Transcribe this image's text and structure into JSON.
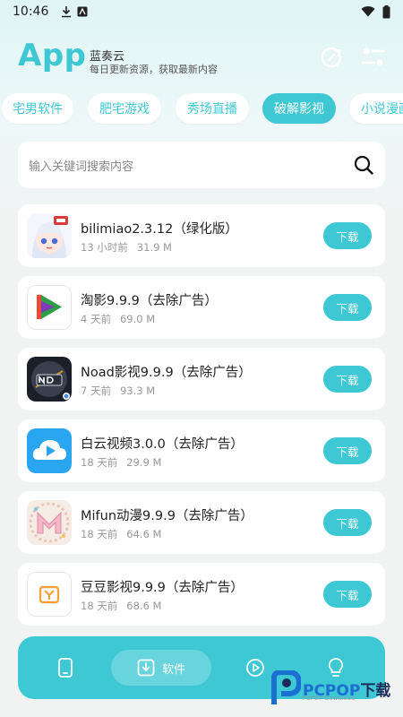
{
  "status_bar": {
    "time": "10:46"
  },
  "header": {
    "logo": "App",
    "name": "蓝奏云",
    "subtitle": "每日更新资源，获取最新内容"
  },
  "tabs": [
    {
      "label": "宅男软件",
      "active": false
    },
    {
      "label": "肥宅游戏",
      "active": false
    },
    {
      "label": "秀场直播",
      "active": false
    },
    {
      "label": "破解影视",
      "active": true
    },
    {
      "label": "小说漫画",
      "active": false
    }
  ],
  "search": {
    "placeholder": "输入关键词搜索内容"
  },
  "list": [
    {
      "title": "bilimiao2.3.12（绿化版）",
      "time": "13 小时前",
      "size": "31.9 M",
      "button": "下载",
      "icon": "bilimiao-icon"
    },
    {
      "title": "淘影9.9.9（去除广告）",
      "time": "4 天前",
      "size": "69.0 M",
      "button": "下载",
      "icon": "taoying-icon"
    },
    {
      "title": "Noad影视9.9.9（去除广告）",
      "time": "7 天前",
      "size": "93.3 M",
      "button": "下载",
      "icon": "noad-icon"
    },
    {
      "title": "白云视频3.0.0（去除广告）",
      "time": "18 天前",
      "size": "29.9 M",
      "button": "下载",
      "icon": "cloud-video-icon"
    },
    {
      "title": "Mifun动漫9.9.9（去除广告）",
      "time": "18 天前",
      "size": "64.6 M",
      "button": "下载",
      "icon": "mifun-icon"
    },
    {
      "title": "豆豆影视9.9.9（去除广告）",
      "time": "18 天前",
      "size": "68.6 M",
      "button": "下载",
      "icon": "doudou-icon"
    }
  ],
  "bottom_nav": {
    "active_label": "软件",
    "items": [
      "phone-icon",
      "download-icon",
      "play-icon",
      "bulb-icon"
    ]
  },
  "watermark": {
    "brand": "PCPOP",
    "suffix": "下载",
    "sub": "PCPOP Download"
  },
  "colors": {
    "accent": "#3ec8d4",
    "background": "#f1f3f3",
    "card": "#ffffff"
  }
}
